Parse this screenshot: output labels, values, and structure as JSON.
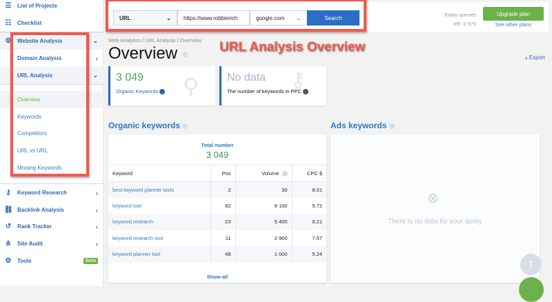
{
  "sidebar": {
    "items": [
      {
        "label": "List of Projects",
        "icon": "list-icon"
      },
      {
        "label": "Checklist",
        "icon": "checklist-icon"
      },
      {
        "label": "Website Analysis",
        "icon": "analytics-icon"
      },
      {
        "label": "Domain Analysis"
      },
      {
        "label": "URL Analysis"
      },
      {
        "label": "Overview"
      },
      {
        "label": "Keywords"
      },
      {
        "label": "Competitors"
      },
      {
        "label": "URL vs URL"
      },
      {
        "label": "Missing Keywords"
      },
      {
        "label": "Keyword Research",
        "icon": "key-icon"
      },
      {
        "label": "Backlink Analysis",
        "icon": "link-icon"
      },
      {
        "label": "Rank Tracker",
        "icon": "history-icon"
      },
      {
        "label": "Site Audit",
        "icon": "sitemap-icon"
      },
      {
        "label": "Tools",
        "icon": "gear-icon",
        "badge": "Beta"
      }
    ]
  },
  "search": {
    "type": "URL",
    "url": "https://www.robbierich",
    "engine": "google.com",
    "button": "Search"
  },
  "queries": {
    "line1": "Today queries",
    "line2": "left: 3 976"
  },
  "upgrade": {
    "button": "Upgrade plan",
    "link": "See other plans"
  },
  "breadcrumb": "Web Analytics / URL Analysis / Overview",
  "title": "Overview",
  "annotation": "URL Analysis Overview",
  "export": "Export",
  "cards": [
    {
      "value": "3 049",
      "label": "Organic Keywords"
    },
    {
      "value": "No data",
      "label": "The number of keywords in PPC"
    }
  ],
  "organic": {
    "title": "Organic keywords",
    "total_label": "Total number",
    "total": "3 049",
    "columns": [
      "Keyword",
      "Pos",
      "Volume",
      "CPC $"
    ],
    "rows": [
      [
        "best keyword planner tools",
        "2",
        "30",
        "8.01"
      ],
      [
        "keyword tool",
        "82",
        "8 100",
        "5.72"
      ],
      [
        "keyword research",
        "23",
        "5 400",
        "6.21"
      ],
      [
        "keyword research tool",
        "11",
        "2 900",
        "7.57"
      ],
      [
        "keyword planner tool",
        "48",
        "1 000",
        "5.24"
      ]
    ],
    "show_all": "Show all"
  },
  "ads": {
    "title": "Ads keywords",
    "empty": "There is no data for your query"
  },
  "colors": {
    "accent": "#2a68b8",
    "green": "#4a9a4e",
    "red": "#f2584b",
    "upgrade": "#6cb24a"
  }
}
